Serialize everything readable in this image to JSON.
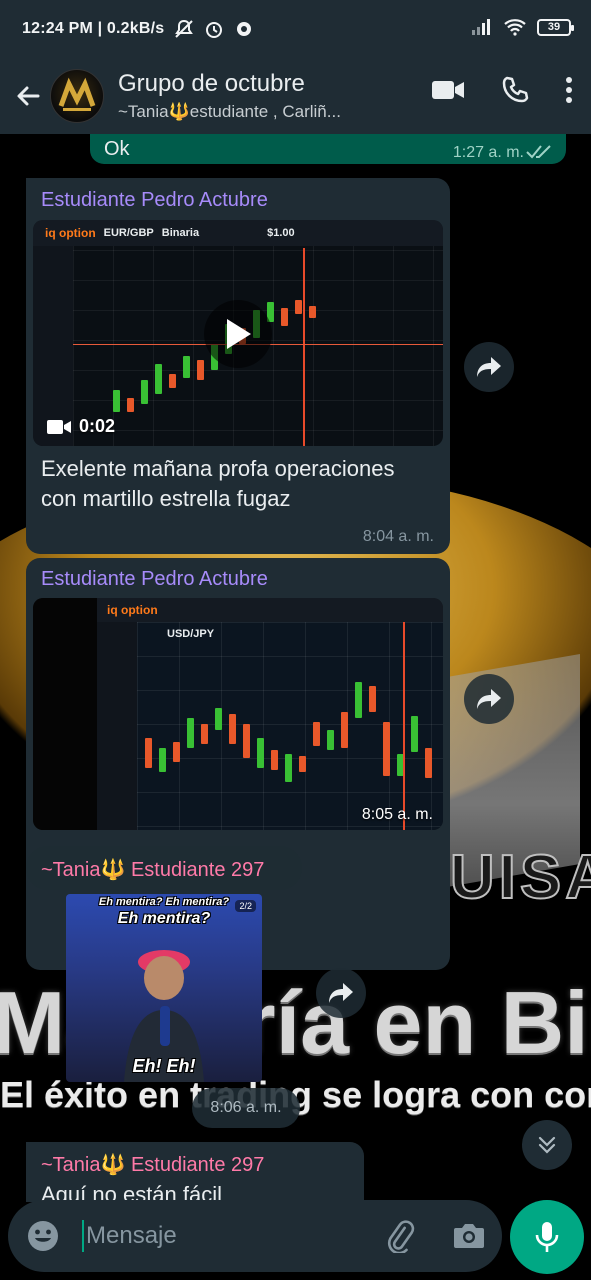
{
  "status_bar": {
    "time_speed": "12:24 PM | 0.2kB/s",
    "battery": "39"
  },
  "header": {
    "title": "Grupo de octubre",
    "subtitle": "~Tania🔱estudiante , Carliñ..."
  },
  "messages": {
    "outgoing": {
      "text": "Ok",
      "time": "1:27 a. m."
    },
    "msg1": {
      "sender": "Estudiante Pedro Actubre",
      "video_duration": "0:02",
      "text": "Exelente mañana profa operaciones con martillo estrella fugaz",
      "time": "8:04 a. m."
    },
    "msg2": {
      "sender": "Estudiante Pedro Actubre",
      "time": "8:05 a. m."
    },
    "msg3": {
      "sender": "~Tania🔱 Estudiante 297",
      "gif_caption_top": "Eh mentira? Eh mentira?",
      "gif_caption_mid": "Eh mentira?",
      "gif_caption_bottom": "Eh! Eh!",
      "gif_counter": "2/2",
      "time": "8:06 a. m."
    },
    "msg4": {
      "sender": "~Tania🔱 Estudiante 297",
      "text": "Aquí no están fácil"
    }
  },
  "wallpaper": {
    "line1": "Maestría en Binarias",
    "line2": "El éxito en trading se logra con conocimiento",
    "brand": "LUISA"
  },
  "media_labels": {
    "iq_option": "iq option",
    "pair1": "EUR/GBP",
    "pair2": "USD/JPY",
    "binaria": "Binaria",
    "price": "$1.00"
  },
  "input": {
    "placeholder": "Mensaje"
  },
  "colors": {
    "header_bg": "#1f2c34",
    "outgoing_bubble": "#005c4b",
    "incoming_bubble": "#1f2c34",
    "accent": "#00a884",
    "sender_purple": "#a78bfa",
    "sender_pink": "#ff7aa8"
  }
}
